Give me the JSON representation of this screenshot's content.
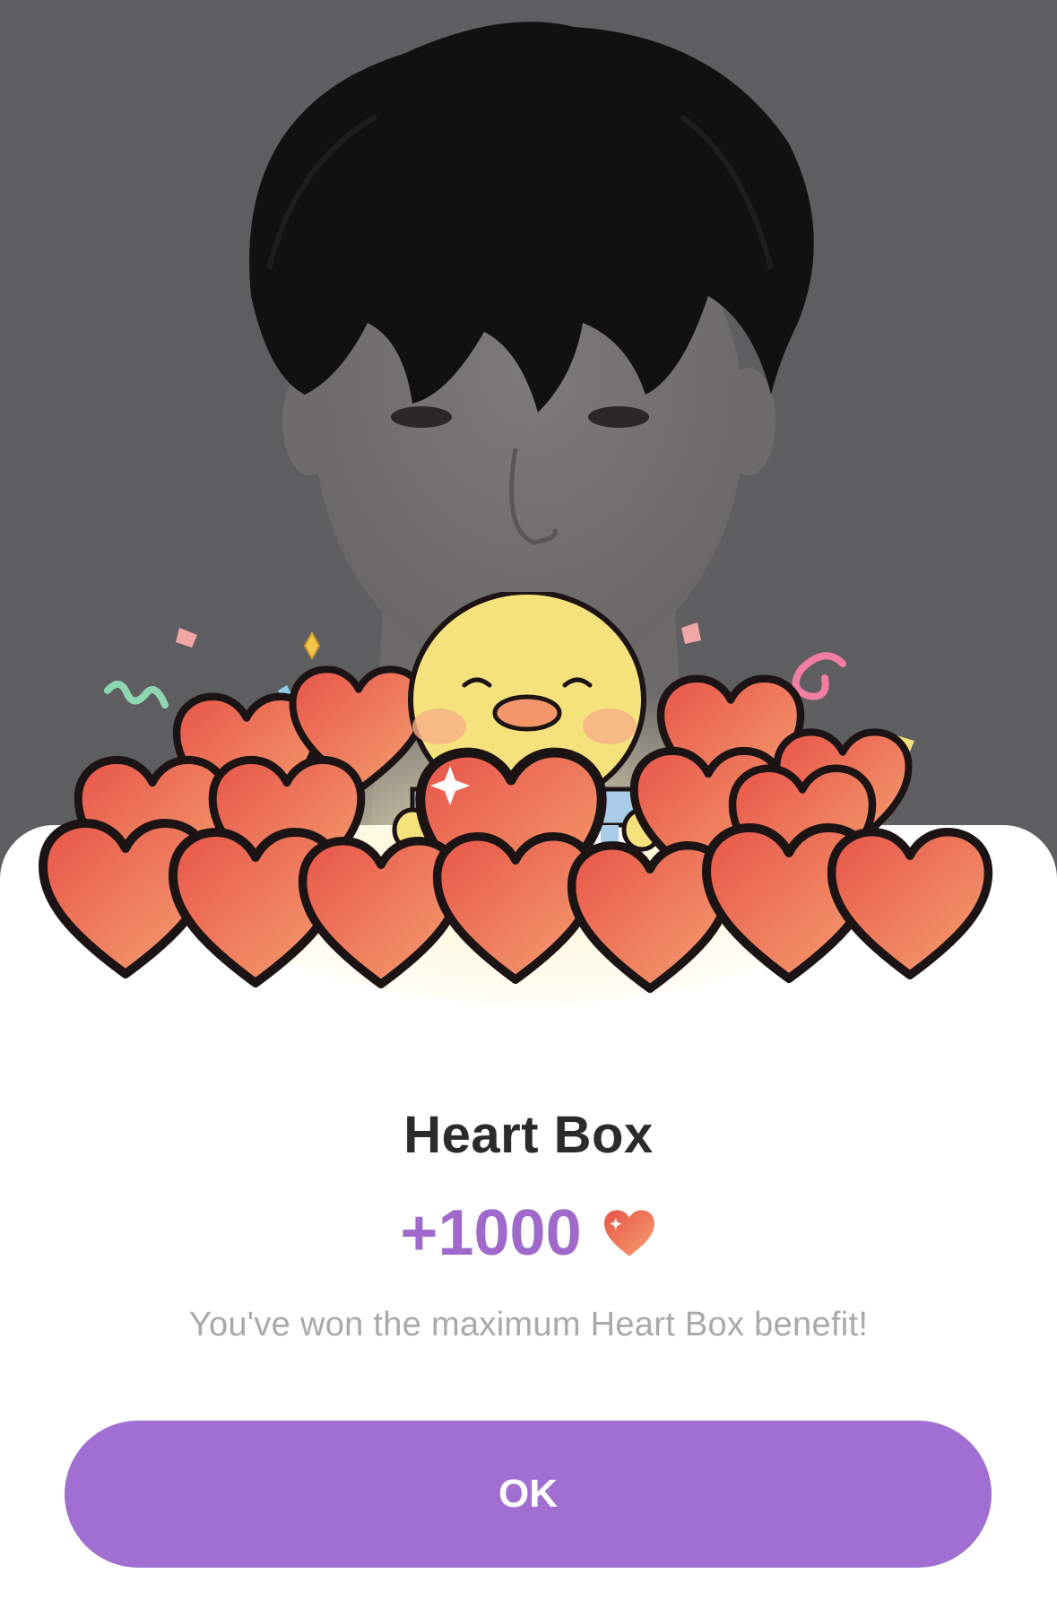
{
  "dialog": {
    "title": "Heart Box",
    "amount": "+1000",
    "reward_icon": "heart-icon",
    "message": "You've won the maximum Heart Box benefit!",
    "ok_label": "OK"
  },
  "colors": {
    "accent": "#a06fd1",
    "amount": "#a06acc",
    "heart_light": "#f5956a",
    "heart_dark": "#e8554a",
    "overlay": "#5d5d60"
  }
}
